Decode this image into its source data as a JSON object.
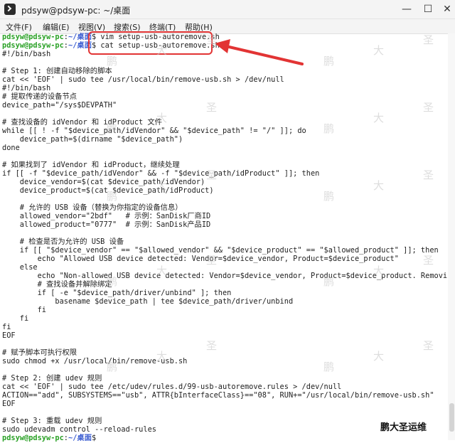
{
  "window": {
    "title": "pdsyw@pdsyw-pc: ~/桌面"
  },
  "menu": [
    "文件(F)",
    "编辑(E)",
    "视图(V)",
    "搜索(S)",
    "终端(T)",
    "帮助(H)"
  ],
  "prompt": {
    "user": "pdsyw@pdsyw-pc",
    "path": "~/桌面",
    "symbol": "$"
  },
  "commands": {
    "cmd1": " vim setup-usb-autoremove.sh",
    "cmd2": " cat setup-usb-autoremove.sh"
  },
  "output": [
    "#!/bin/bash",
    "",
    "# Step 1: 创建自动移除的脚本",
    "cat << 'EOF' | sudo tee /usr/local/bin/remove-usb.sh > /dev/null",
    "#!/bin/bash",
    "# 提取传递的设备节点",
    "device_path=\"/sys$DEVPATH\"",
    "",
    "# 查找设备的 idVendor 和 idProduct 文件",
    "while [[ ! -f \"$device_path/idVendor\" && \"$device_path\" != \"/\" ]]; do",
    "    device_path=$(dirname \"$device_path\")",
    "done",
    "",
    "# 如果找到了 idVendor 和 idProduct，继续处理",
    "if [[ -f \"$device_path/idVendor\" && -f \"$device_path/idProduct\" ]]; then",
    "    device_vendor=$(cat $device_path/idVendor)",
    "    device_product=$(cat $device_path/idProduct)",
    "",
    "    # 允许的 USB 设备（替换为你指定的设备信息）",
    "    allowed_vendor=\"2bdf\"   # 示例：SanDisk厂商ID",
    "    allowed_product=\"0777\"  # 示例：SanDisk产品ID",
    "",
    "    # 检查是否为允许的 USB 设备",
    "    if [[ \"$device_vendor\" == \"$allowed_vendor\" && \"$device_product\" == \"$allowed_product\" ]]; then",
    "        echo \"Allowed USB device detected: Vendor=$device_vendor, Product=$device_product\"",
    "    else",
    "        echo \"Non-allowed USB device detected: Vendor=$device_vendor, Product=$device_product. Removing...\"",
    "        # 查找设备并解除绑定",
    "        if [ -e \"$device_path/driver/unbind\" ]; then",
    "            basename $device_path | tee $device_path/driver/unbind",
    "        fi",
    "    fi",
    "fi",
    "EOF",
    "",
    "# 赋予脚本可执行权限",
    "sudo chmod +x /usr/local/bin/remove-usb.sh",
    "",
    "# Step 2: 创建 udev 规则",
    "cat << 'EOF' | sudo tee /etc/udev/rules.d/99-usb-autoremove.rules > /dev/null",
    "ACTION==\"add\", SUBSYSTEMS==\"usb\", ATTR{bInterfaceClass}==\"08\", RUN+=\"/usr/local/bin/remove-usb.sh\"",
    "EOF",
    "",
    "# Step 3: 重载 udev 规则",
    "sudo udevadm control --reload-rules"
  ],
  "watermark": [
    "鹏",
    "大",
    "圣"
  ],
  "brand": "鹏大圣运维",
  "colors": {
    "prompt_user": "#2aa126",
    "prompt_path": "#3b5dd1",
    "annotation": "#e23434"
  }
}
